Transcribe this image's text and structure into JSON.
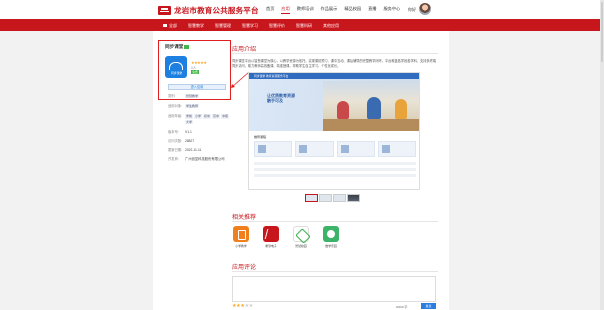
{
  "header": {
    "logo_text": "龙岩市教育公共服务平台",
    "nav": [
      "首页",
      "应用",
      "教师培训",
      "作品展示",
      "精品校园",
      "直播",
      "服务中心"
    ],
    "active_nav_index": 1,
    "user_label": "你好"
  },
  "redbar": {
    "category_label": "全部",
    "items": [
      "智慧教学",
      "智慧管理",
      "智慧学习",
      "智慧评价",
      "智慧科研",
      "其他应用"
    ]
  },
  "app": {
    "title": "同步课堂",
    "icon_text": "同步课堂",
    "stars": "★★★★★",
    "rating_count": "0人",
    "free_badge": "免费",
    "enter_button": "进入应用"
  },
  "info": [
    {
      "k": "类别:",
      "v": [
        "智慧教学"
      ]
    },
    {
      "k": "适用对象:",
      "v": [
        "学生教师"
      ]
    },
    {
      "k": "适用年级:",
      "v": [
        "学前",
        "小学",
        "初中",
        "高中",
        "中职",
        "大学"
      ]
    },
    {
      "k": "版本号:",
      "v": [
        "V1.1"
      ]
    },
    {
      "k": "访问次数:",
      "v": [
        "28827"
      ]
    },
    {
      "k": "更新日期:",
      "v": [
        "2022-11-11"
      ]
    },
    {
      "k": "开发商:",
      "v": [
        "广州创显科技股份有限公司"
      ]
    }
  ],
  "sections": {
    "intro_title": "应用介绍",
    "recommend_title": "相关推荐",
    "comments_title": "应用评论"
  },
  "description": "同步课堂平台以智慧课堂为核心，以教学资源为依托，实现课前预习、课中互动、课后辅导的完整教学闭环。平台覆盖各学段各学科，支持多终端同步访问，助力教师高效备课、精准授课，帮助学生自主学习、个性化成长。",
  "screenshot": {
    "topbar_text": "同步课堂 教育资源服务平台",
    "hero_text": "让优质教育资源\n触手可及",
    "sub_text": "推荐课程"
  },
  "recommended_apps": [
    {
      "name": "小学教学",
      "icon": "book-icon",
      "color": "#f07f1d"
    },
    {
      "name": "希望电子",
      "icon": "pen-icon",
      "color": "#c8161d"
    },
    {
      "name": "智慧校园",
      "icon": "diamond-icon",
      "color": "#39b54a"
    },
    {
      "name": "数学乐园",
      "icon": "face-icon",
      "color": "#3db36a"
    }
  ],
  "comments": {
    "stars_on": "★★★",
    "stars_off": "★★",
    "count_text": "0/200 字",
    "submit_label": "发表"
  }
}
